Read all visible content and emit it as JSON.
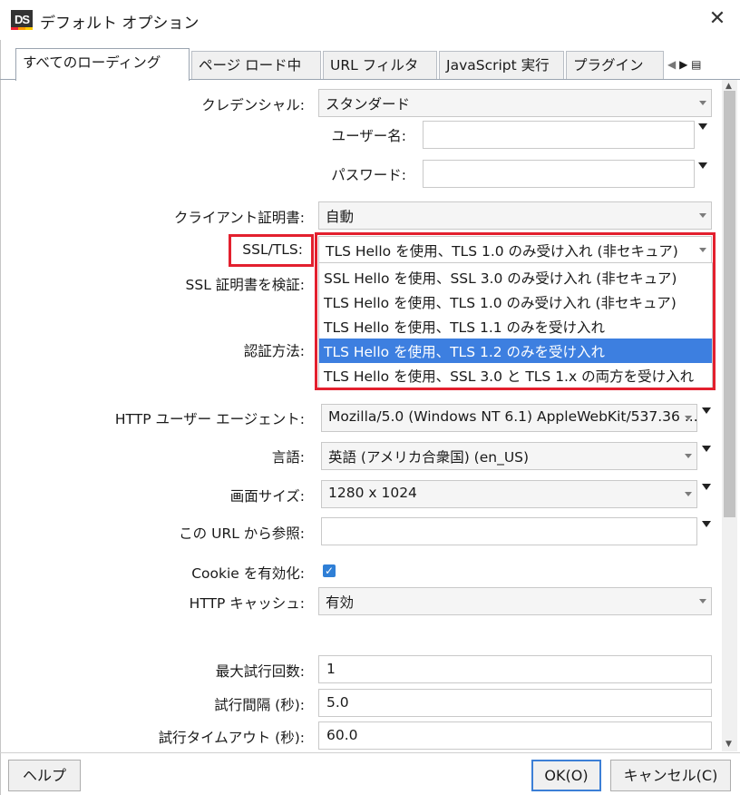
{
  "window": {
    "title": "デフォルト オプション",
    "logo": "DS",
    "close_icon": "close-icon"
  },
  "tabs": [
    {
      "label": "すべてのローディング",
      "active": true
    },
    {
      "label": "ページ ロード中",
      "active": false
    },
    {
      "label": "URL フィルタ",
      "active": false
    },
    {
      "label": "JavaScript 実行",
      "active": false
    },
    {
      "label": "プラグイン",
      "active": false
    }
  ],
  "tab_scroll": {
    "left": "◀",
    "right": "▶",
    "menu": "▤"
  },
  "form": {
    "credential_label": "クレデンシャル:",
    "credential_value": "スタンダード",
    "username_label": "ユーザー名:",
    "username_value": "",
    "password_label": "パスワード:",
    "password_value": "",
    "client_cert_label": "クライアント証明書:",
    "client_cert_value": "自動",
    "ssl_label": "SSL/TLS:",
    "ssl_value": "TLS Hello を使用、TLS 1.0 のみ受け入れ (非セキュア)",
    "ssl_verify_label": "SSL 証明書を検証:",
    "auth_method_label": "認証方法:",
    "ssl_options": [
      {
        "label": "SSL Hello を使用、SSL 3.0 のみ受け入れ (非セキュア)",
        "selected": false
      },
      {
        "label": "TLS Hello を使用、TLS 1.0 のみ受け入れ (非セキュア)",
        "selected": false
      },
      {
        "label": "TLS Hello を使用、TLS 1.1 のみを受け入れ",
        "selected": false
      },
      {
        "label": "TLS Hello を使用、TLS 1.2 のみを受け入れ",
        "selected": true
      },
      {
        "label": "TLS Hello を使用、SSL 3.0 と TLS 1.x の両方を受け入れ",
        "selected": false
      }
    ],
    "user_agent_label": "HTTP ユーザー エージェント:",
    "user_agent_value": "Mozilla/5.0 (Windows NT 6.1) AppleWebKit/537.36 ...",
    "language_label": "言語:",
    "language_value": "英語 (アメリカ合衆国) (en_US)",
    "screen_size_label": "画面サイズ:",
    "screen_size_value": "1280 x 1024",
    "referrer_label": "この URL から参照:",
    "referrer_value": "",
    "cookie_label": "Cookie を有効化:",
    "cookie_checked": true,
    "cookie_check": "✓",
    "cache_label": "HTTP キャッシュ:",
    "cache_value": "有効",
    "max_retries_label": "最大試行回数:",
    "max_retries_value": "1",
    "retry_interval_label": "試行間隔 (秒):",
    "retry_interval_value": "5.0",
    "retry_timeout_label": "試行タイムアウト (秒):",
    "retry_timeout_value": "60.0"
  },
  "buttons": {
    "help": "ヘルプ",
    "ok": "OK(O)",
    "cancel": "キャンセル(C)"
  },
  "colors": {
    "highlight": "#e3202e",
    "selection": "#3d7fe0"
  }
}
